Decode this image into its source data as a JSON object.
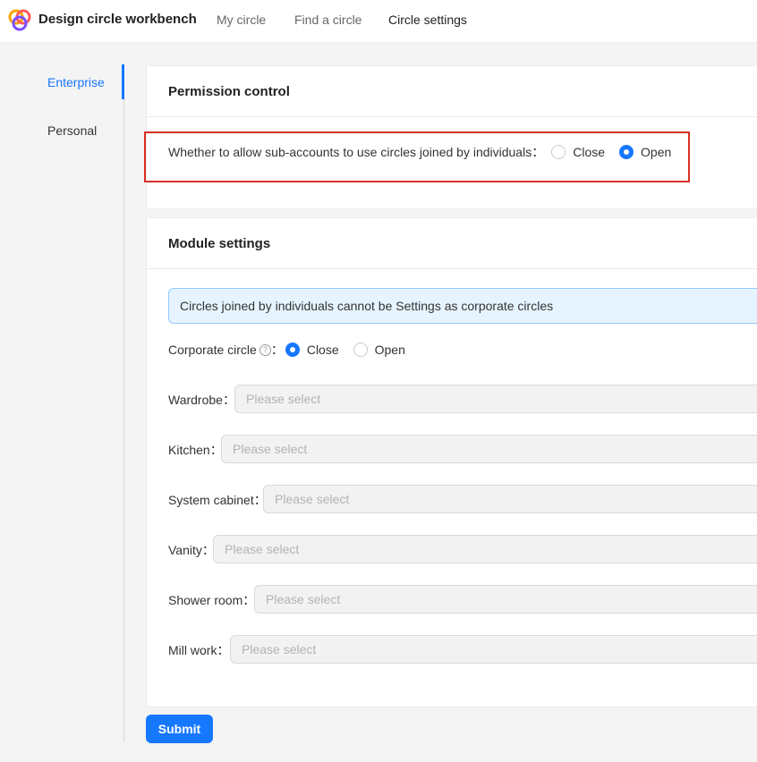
{
  "header": {
    "app_title": "Design circle workbench",
    "nav": [
      "My circle",
      "Find a circle",
      "Circle settings"
    ],
    "active_nav": "Circle settings"
  },
  "sidebar": {
    "items": [
      "Enterprise",
      "Personal"
    ],
    "active": "Enterprise"
  },
  "permission": {
    "title": "Permission control",
    "question": "Whether to allow sub-accounts to use circles joined by individuals：",
    "options": [
      "Close",
      "Open"
    ],
    "selected": "Open"
  },
  "module": {
    "title": "Module settings",
    "info": "Circles joined by individuals cannot be Settings as corporate circles",
    "corporate_label": "Corporate circle",
    "corporate_colon": "：",
    "corporate_options": [
      "Close",
      "Open"
    ],
    "corporate_selected": "Close",
    "fields": [
      {
        "label": "Wardrobe：",
        "placeholder": "Please select"
      },
      {
        "label": "Kitchen：",
        "placeholder": "Please select"
      },
      {
        "label": "System cabinet：",
        "placeholder": "Please select"
      },
      {
        "label": "Vanity：",
        "placeholder": "Please select"
      },
      {
        "label": "Shower room：",
        "placeholder": "Please select"
      },
      {
        "label": "Mill work：",
        "placeholder": "Please select"
      }
    ]
  },
  "submit_label": "Submit",
  "colors": {
    "accent": "#1677ff",
    "highlight": "#d93025",
    "info_bg": "#e6f4ff"
  }
}
